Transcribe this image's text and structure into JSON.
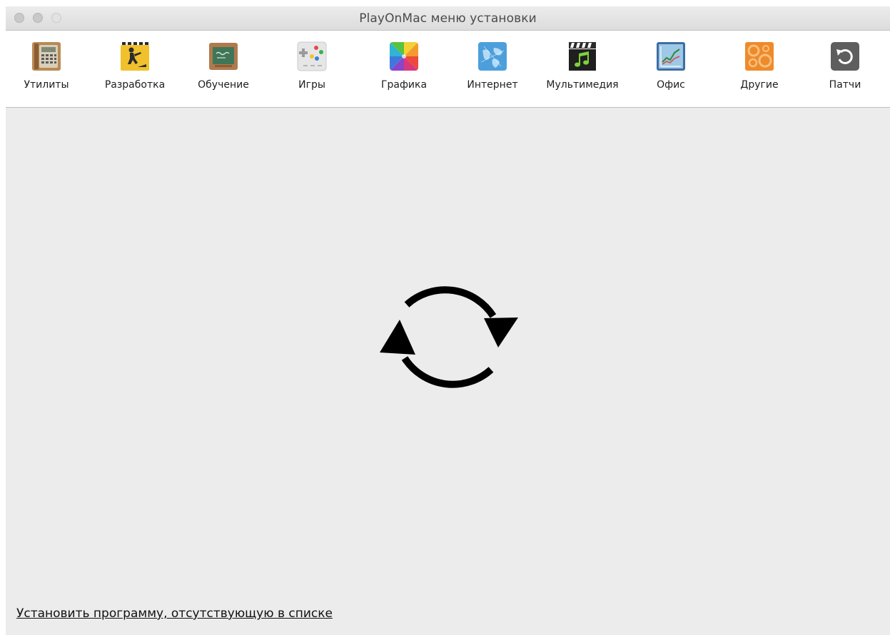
{
  "window": {
    "title": "PlayOnMac меню установки"
  },
  "toolbar": {
    "items": [
      {
        "label": "Утилиты",
        "icon": "calculator-icon"
      },
      {
        "label": "Разработка",
        "icon": "construction-worker-icon"
      },
      {
        "label": "Обучение",
        "icon": "chalkboard-icon"
      },
      {
        "label": "Игры",
        "icon": "gamepad-icon"
      },
      {
        "label": "Графика",
        "icon": "color-wheel-icon"
      },
      {
        "label": "Интернет",
        "icon": "globe-icon"
      },
      {
        "label": "Мультимедия",
        "icon": "film-music-icon"
      },
      {
        "label": "Офис",
        "icon": "chart-icon"
      },
      {
        "label": "Другие",
        "icon": "gears-icon"
      },
      {
        "label": "Патчи",
        "icon": "undo-arrow-icon"
      }
    ]
  },
  "content": {
    "loading_icon": "refresh-icon",
    "install_link": "Установить программу, отсутствующую в списке"
  },
  "colors": {
    "window_bg": "#ececec",
    "toolbar_bg": "#ffffff",
    "spinner": "#000000"
  }
}
